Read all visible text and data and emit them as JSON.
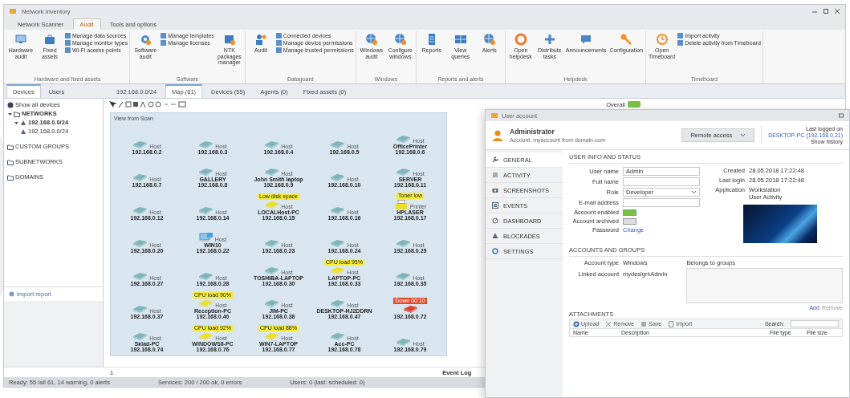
{
  "main": {
    "window": {
      "title": "Network Inventory"
    },
    "ribbon_tabs": [
      {
        "label": "Network Scanner",
        "selected": false
      },
      {
        "label": "Audit",
        "selected": true
      },
      {
        "label": "Tools and options",
        "selected": false
      }
    ],
    "ribbon_groups": [
      {
        "label": "Hardware and fixed assets",
        "items": [
          {
            "kind": "large",
            "label": "Hardware audit"
          },
          {
            "kind": "large",
            "label": "Fixed assets"
          },
          {
            "kind": "stack",
            "entries": [
              "Manage data sources",
              "Manage monitor types",
              "Wi-Fi access points"
            ]
          }
        ]
      },
      {
        "label": "Software",
        "items": [
          {
            "kind": "large",
            "label": "Software audit"
          },
          {
            "kind": "stack",
            "entries": [
              "Manage templates",
              "Manage licenses"
            ]
          },
          {
            "kind": "large",
            "label": "NTK packages manager"
          }
        ]
      },
      {
        "label": "Dataguard",
        "items": [
          {
            "kind": "large",
            "label": "Audit"
          },
          {
            "kind": "stack",
            "entries": [
              "Connected devices",
              "Manage device permissions",
              "Manage trusted permissions"
            ]
          }
        ]
      },
      {
        "label": "Windows",
        "items": [
          {
            "kind": "large",
            "label": "Windows audit"
          },
          {
            "kind": "large",
            "label": "Configure windows"
          }
        ]
      },
      {
        "label": "Reports and alerts",
        "items": [
          {
            "kind": "large",
            "label": "Reports"
          },
          {
            "kind": "large",
            "label": "View queries"
          },
          {
            "kind": "large",
            "label": "Alerts"
          }
        ]
      },
      {
        "label": "Helpdesk",
        "items": [
          {
            "kind": "large",
            "label": "Open helpdesk"
          },
          {
            "kind": "large",
            "label": "Distribute tasks"
          },
          {
            "kind": "large",
            "label": "Announcements"
          },
          {
            "kind": "large",
            "label": "Configuration"
          }
        ]
      },
      {
        "label": "Timeboard",
        "items": [
          {
            "kind": "large",
            "label": "Open Timeboard"
          },
          {
            "kind": "stack",
            "entries": [
              "Import activity",
              "Delete activity from Timeboard"
            ]
          }
        ]
      }
    ],
    "side_tabs": [
      {
        "label": "Devices",
        "selected": true
      },
      {
        "label": "Users",
        "selected": false
      }
    ],
    "doc_tabs": [
      {
        "label": "192.168.0.0/24",
        "selected": false
      },
      {
        "label": "Map (61)",
        "selected": true
      },
      {
        "label": "Devices (55)",
        "selected": false
      },
      {
        "label": "Agents (0)",
        "selected": false
      },
      {
        "label": "Fixed assets (0)",
        "selected": false
      }
    ],
    "tree": [
      {
        "label": "Show all devices",
        "kind": "all"
      },
      {
        "label": "NETWORKS",
        "kind": "folder",
        "expanded": true,
        "children": [
          {
            "label": "192.168.0.0/24",
            "kind": "net",
            "expanded": true,
            "children": [
              {
                "label": "192.168.0.0/24",
                "kind": "net"
              }
            ]
          }
        ]
      },
      {
        "label": "CUSTOM GROUPS",
        "kind": "folder"
      },
      {
        "label": "SUBNETWORKS",
        "kind": "folder"
      },
      {
        "label": "DOMAINS",
        "kind": "folder"
      }
    ],
    "import_link": "Import report",
    "overall": {
      "label": "Overall",
      "on": true
    },
    "map": {
      "title": "View from Scan",
      "nodes": [
        {
          "kind": "device",
          "warning": false,
          "down": false,
          "caption": "Host",
          "lines": [
            "192.168.0.2"
          ]
        },
        {
          "kind": "device",
          "warning": false,
          "down": false,
          "caption": "Host",
          "lines": [
            "192.168.0.3"
          ]
        },
        {
          "kind": "device",
          "warning": false,
          "down": false,
          "caption": "Host",
          "lines": [
            "192.168.0.4"
          ]
        },
        {
          "kind": "device",
          "warning": false,
          "down": false,
          "caption": "Host",
          "lines": [
            "192.168.0.5"
          ]
        },
        {
          "kind": "device",
          "warning": false,
          "down": false,
          "caption": "Host",
          "lines": [
            "OfficePrinter",
            "192.168.0.6"
          ]
        },
        {
          "kind": "device",
          "warning": false,
          "down": false,
          "caption": "Host",
          "lines": [
            "192.168.0.7"
          ]
        },
        {
          "kind": "device",
          "warning": false,
          "down": false,
          "caption": "Host",
          "lines": [
            "GALLERY",
            "192.168.0.8"
          ]
        },
        {
          "kind": "device",
          "warning": false,
          "down": false,
          "caption": "Host",
          "lines": [
            "John Smith laptop",
            "192.168.0.9"
          ]
        },
        {
          "kind": "device",
          "warning": false,
          "down": false,
          "caption": "Host",
          "lines": [
            "192.168.0.10"
          ]
        },
        {
          "kind": "device",
          "warning": false,
          "down": false,
          "caption": "Host",
          "lines": [
            "SERVER",
            "192.168.0.11"
          ]
        },
        {
          "kind": "device",
          "warning": false,
          "down": false,
          "caption": "Host",
          "lines": [
            "192.168.0.12"
          ]
        },
        {
          "kind": "device",
          "warning": false,
          "down": false,
          "caption": "Host",
          "lines": [
            "192.168.0.14"
          ]
        },
        {
          "kind": "device",
          "warning": true,
          "down": false,
          "caption": "Host",
          "tag": "Low disk space",
          "lines": [
            "LOCALHost-PC",
            "192.168.0.15"
          ]
        },
        {
          "kind": "device",
          "warning": false,
          "down": false,
          "caption": "Host",
          "lines": [
            "192.168.0.16"
          ]
        },
        {
          "kind": "printer",
          "warning": true,
          "down": false,
          "caption": "Printer",
          "tag": "Toner low",
          "lines": [
            "HPLASER",
            "192.168.0.17"
          ]
        },
        {
          "kind": "device",
          "warning": false,
          "down": false,
          "caption": "Host",
          "lines": [
            "192.168.0.20"
          ]
        },
        {
          "kind": "computer",
          "warning": false,
          "down": false,
          "caption": "Host",
          "lines": [
            "WIN10",
            "192.168.0.22"
          ]
        },
        {
          "kind": "device",
          "warning": false,
          "down": false,
          "caption": "Host",
          "lines": [
            "192.168.0.23"
          ]
        },
        {
          "kind": "device",
          "warning": false,
          "down": false,
          "caption": "Host",
          "lines": [
            "192.168.0.24"
          ]
        },
        {
          "kind": "device",
          "warning": false,
          "down": false,
          "caption": "Host",
          "lines": [
            "192.168.0.25"
          ]
        },
        {
          "kind": "device",
          "warning": false,
          "down": false,
          "caption": "Host",
          "lines": [
            "192.168.0.27"
          ]
        },
        {
          "kind": "device",
          "warning": false,
          "down": false,
          "caption": "Host",
          "lines": [
            "192.168.0.28"
          ]
        },
        {
          "kind": "device",
          "warning": false,
          "down": false,
          "caption": "Host",
          "lines": [
            "TOSHIBA-LAPTOP",
            "192.168.0.30"
          ]
        },
        {
          "kind": "device",
          "warning": true,
          "down": false,
          "caption": "Host",
          "tag": "CPU load 95%",
          "lines": [
            "LAPTOP-PC",
            "192.168.0.33"
          ]
        },
        {
          "kind": "device",
          "warning": false,
          "down": false,
          "caption": "Host",
          "lines": [
            "192.168.0.35"
          ]
        },
        {
          "kind": "device",
          "warning": false,
          "down": false,
          "caption": "Host",
          "lines": [
            "192.168.0.37"
          ]
        },
        {
          "kind": "device",
          "warning": true,
          "down": false,
          "caption": "Host",
          "tag": "CPU load 90%",
          "lines": [
            "Reception-PC",
            "192.168.0.40"
          ]
        },
        {
          "kind": "device",
          "warning": false,
          "down": false,
          "caption": "Host",
          "lines": [
            "JIM-PC",
            "192.168.0.38"
          ]
        },
        {
          "kind": "device",
          "warning": false,
          "down": false,
          "caption": "Host",
          "lines": [
            "DESKTOP-HJ2DDRN",
            "192.168.0.47"
          ]
        },
        {
          "kind": "device",
          "warning": false,
          "down": true,
          "tag": "Down 00:10",
          "lines": [
            "192.168.0.72"
          ]
        },
        {
          "kind": "device",
          "warning": false,
          "down": false,
          "caption": "Host",
          "lines": [
            "Sklad-PC",
            "192.168.0.74"
          ]
        },
        {
          "kind": "device",
          "warning": true,
          "down": false,
          "caption": "Host",
          "tag": "CPU load 92%",
          "lines": [
            "WINDOWS8-PC",
            "192.168.0.76"
          ]
        },
        {
          "kind": "device",
          "warning": true,
          "down": false,
          "caption": "Host",
          "tag": "CPU load 88%",
          "lines": [
            "WIN7-LAPTOP",
            "192.168.0.77"
          ]
        },
        {
          "kind": "device",
          "warning": false,
          "down": false,
          "caption": "Host",
          "lines": [
            "Acc-PC",
            "192.168.0.78"
          ]
        },
        {
          "kind": "device",
          "warning": false,
          "down": false,
          "caption": "Host",
          "lines": [
            "192.168.0.79"
          ]
        }
      ]
    },
    "event_log": {
      "marker": "1",
      "label": "Event Log"
    },
    "status_bar": [
      "Ready: 55 /all 61, 14 warning, 0 alerts",
      "Services: 200 / 200 ok, 0 errors",
      "Users: 0 (last: scheduled: 0)"
    ]
  },
  "user": {
    "window": {
      "title": "User account"
    },
    "name": "Administrator",
    "subtitle": "Account: myaccount from domain.com",
    "remote_button": "Remote access",
    "last_logged_label": "Last logged on",
    "last_logged_link": "DESKTOP-PC (192.168.0.21)",
    "history_link": "Show history",
    "nav": [
      {
        "label": "GENERAL",
        "selected": true
      },
      {
        "label": "ACTIVITY",
        "selected": false
      },
      {
        "label": "SCREENSHOTS",
        "selected": false
      },
      {
        "label": "EVENTS",
        "selected": false
      },
      {
        "label": "DASHBOARD",
        "selected": false
      },
      {
        "label": "BLOCKADES",
        "selected": false
      },
      {
        "label": "SETTINGS",
        "selected": false
      }
    ],
    "info_header": "USER INFO AND STATUS",
    "fields": [
      {
        "kind": "text",
        "label": "User name",
        "value": "Admin"
      },
      {
        "kind": "text",
        "label": "Full name"
      },
      {
        "kind": "select",
        "label": "Role",
        "value": "Developer"
      },
      {
        "kind": "text",
        "label": "E-mail address"
      },
      {
        "kind": "toggle",
        "label": "Account enabled",
        "on": true
      },
      {
        "kind": "toggle",
        "label": "Account archived",
        "on": false
      },
      {
        "kind": "link",
        "label": "Password",
        "value": "Change"
      }
    ],
    "facts": [
      {
        "label": "Created",
        "lines": [
          "28.05.2018 17:22:48"
        ]
      },
      {
        "label": "Last login",
        "lines": [
          "28.05.2018 17:22:48"
        ]
      },
      {
        "label": "Application",
        "lines": [
          "Workstation",
          "User Activity"
        ]
      }
    ],
    "groups_header": "ACCOUNTS AND GROUPS",
    "account": [
      {
        "label": "Account type",
        "value": "Windows"
      },
      {
        "label": "Linked account",
        "value": "mydesign\\Admin"
      }
    ],
    "belongs_label": "Belongs to groups",
    "add_link": "Add",
    "remove_link": "Remove",
    "attachments_header": "ATTACHMENTS",
    "attach_actions": [
      "Upload",
      "Remove",
      "Save",
      "Import"
    ],
    "search_label": "Search:",
    "columns": [
      "Name",
      "Description",
      "File type",
      "File size"
    ]
  }
}
